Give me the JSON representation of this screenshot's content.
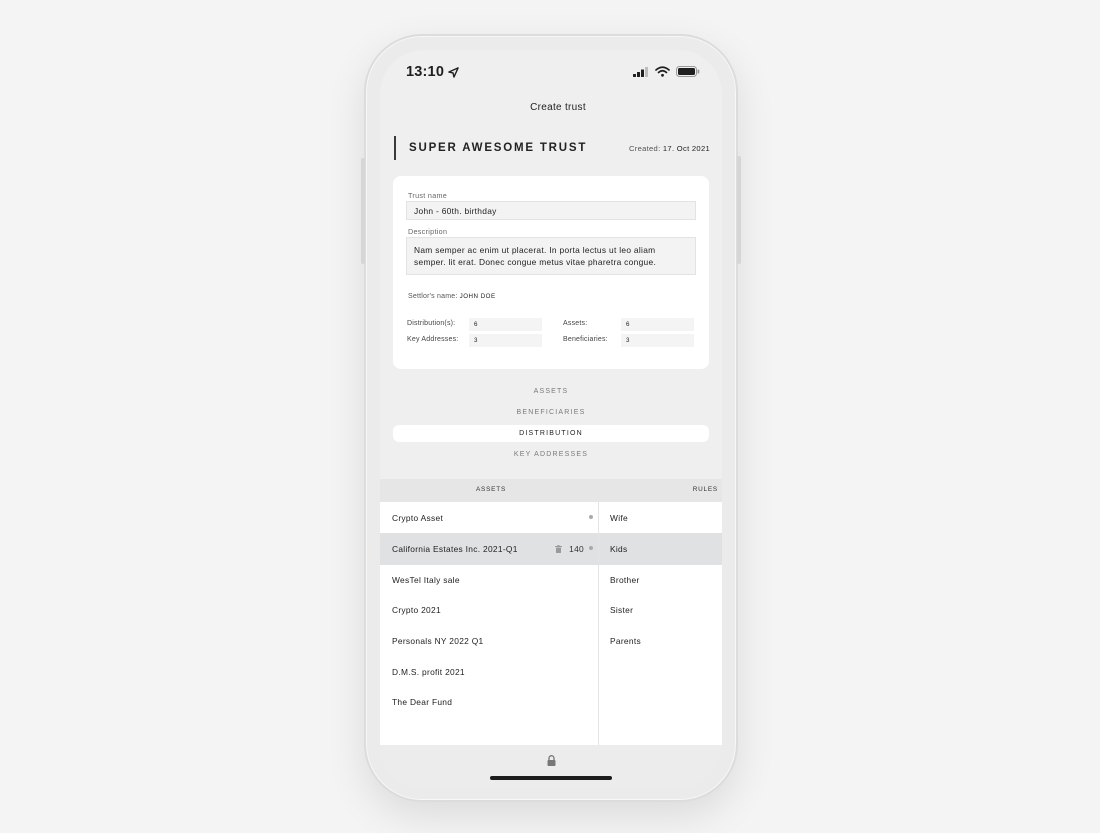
{
  "status_bar": {
    "time": "13:10"
  },
  "nav": {
    "title": "Create trust"
  },
  "trust": {
    "title": "SUPER AWESOME TRUST",
    "created_label": "Created:",
    "created_date": "17. Oct 2021"
  },
  "form": {
    "name_label": "Trust name",
    "name_value": "John - 60th. birthday",
    "description_label": "Description",
    "description_value": "Nam semper ac enim ut placerat. In porta lectus ut leo aliam semper. lit erat. Donec congue metus vitae pharetra congue.",
    "settlor_label": "Settlor's name:",
    "settlor_value": "JOHN DOE",
    "stats": {
      "distributions_label": "Distribution(s):",
      "distributions_value": "6",
      "assets_label": "Assets:",
      "assets_value": "6",
      "key_addresses_label": "Key Addresses:",
      "key_addresses_value": "3",
      "beneficiaries_label": "Beneficiaries:",
      "beneficiaries_value": "3"
    }
  },
  "tabs": [
    {
      "label": "ASSETS",
      "active": false
    },
    {
      "label": "BENEFICIARIES",
      "active": false
    },
    {
      "label": "DISTRIBUTION",
      "active": true
    },
    {
      "label": "KEY ADDRESSES",
      "active": false
    }
  ],
  "table": {
    "assets_header": "ASSETS",
    "rules_header": "RULES",
    "assets": [
      {
        "name": "Crypto Asset"
      },
      {
        "name": "California Estates Inc. 2021-Q1",
        "qty": "140",
        "selected": true
      },
      {
        "name": "WesTel Italy sale"
      },
      {
        "name": "Crypto 2021"
      },
      {
        "name": "Personals NY 2022 Q1"
      },
      {
        "name": "D.M.S. profit 2021"
      },
      {
        "name": "The Dear Fund"
      }
    ],
    "rules": [
      {
        "name": "Wife"
      },
      {
        "name": "Kids",
        "selected": true
      },
      {
        "name": "Brother"
      },
      {
        "name": "Sister"
      },
      {
        "name": "Parents"
      }
    ]
  },
  "icons": {
    "location": "location-arrow-icon",
    "signal": "cellular-signal-icon",
    "wifi": "wifi-icon",
    "battery": "battery-icon",
    "trash": "trash-icon",
    "lock": "lock-icon"
  },
  "colors": {
    "background": "#f4f4f4",
    "screen": "#efefef",
    "card": "#ffffff",
    "selected_row": "#dfe1e2",
    "text": "#1f1f1f"
  }
}
